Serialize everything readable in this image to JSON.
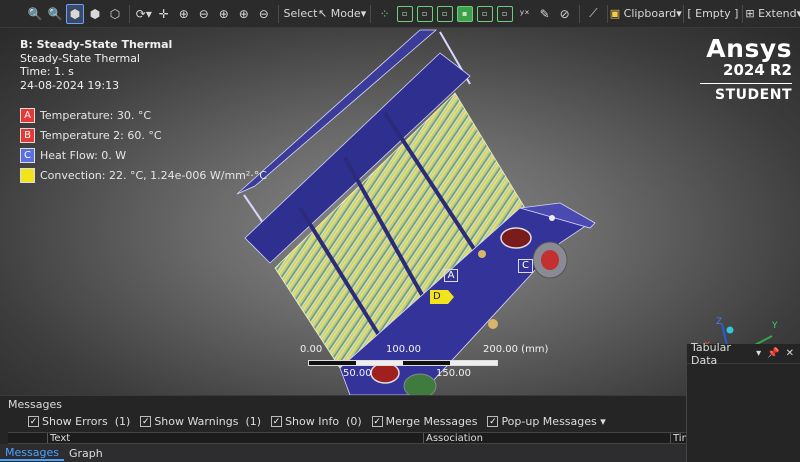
{
  "toolbar": {
    "select_label": "Select",
    "mode_label": "Mode",
    "clipboard_label": "Clipboard",
    "empty_label": "[ Empty ]",
    "extend_label": "Extend"
  },
  "info": {
    "title": "B: Steady-State Thermal",
    "subtitle": "Steady-State Thermal",
    "time": "Time: 1. s",
    "date": "24-08-2024 19:13"
  },
  "legend": [
    {
      "letter": "A",
      "text": "Temperature: 30. °C",
      "color": "#e53935"
    },
    {
      "letter": "B",
      "text": "Temperature 2: 60. °C",
      "color": "#e53935"
    },
    {
      "letter": "C",
      "text": "Heat Flow: 0. W",
      "color": "#5b6ee1"
    },
    {
      "letter": "D",
      "text": "Convection: 22. °C, 1.24e-006 W/mm²·°C",
      "color": "#f2e41c"
    }
  ],
  "brand": {
    "name": "Ansys",
    "version": "2024 R2",
    "edition": "STUDENT"
  },
  "scale": {
    "t0": "0.00",
    "t100": "100.00",
    "t200": "200.00 (mm)",
    "t50": "50.00",
    "t150": "150.00"
  },
  "labels": {
    "a": "A",
    "c": "C",
    "d": "D"
  },
  "messages": {
    "title": "Messages",
    "show_errors": "Show Errors",
    "errors_count": "(1)",
    "show_warnings": "Show Warnings",
    "warnings_count": "(1)",
    "show_info": "Show Info",
    "info_count": "(0)",
    "merge": "Merge Messages",
    "popup": "Pop-up Messages",
    "col_text": "Text",
    "col_assoc": "Association",
    "col_time": "Time"
  },
  "tabs": {
    "messages": "Messages",
    "graph": "Graph"
  },
  "tabular": {
    "title": "Tabular Data"
  }
}
